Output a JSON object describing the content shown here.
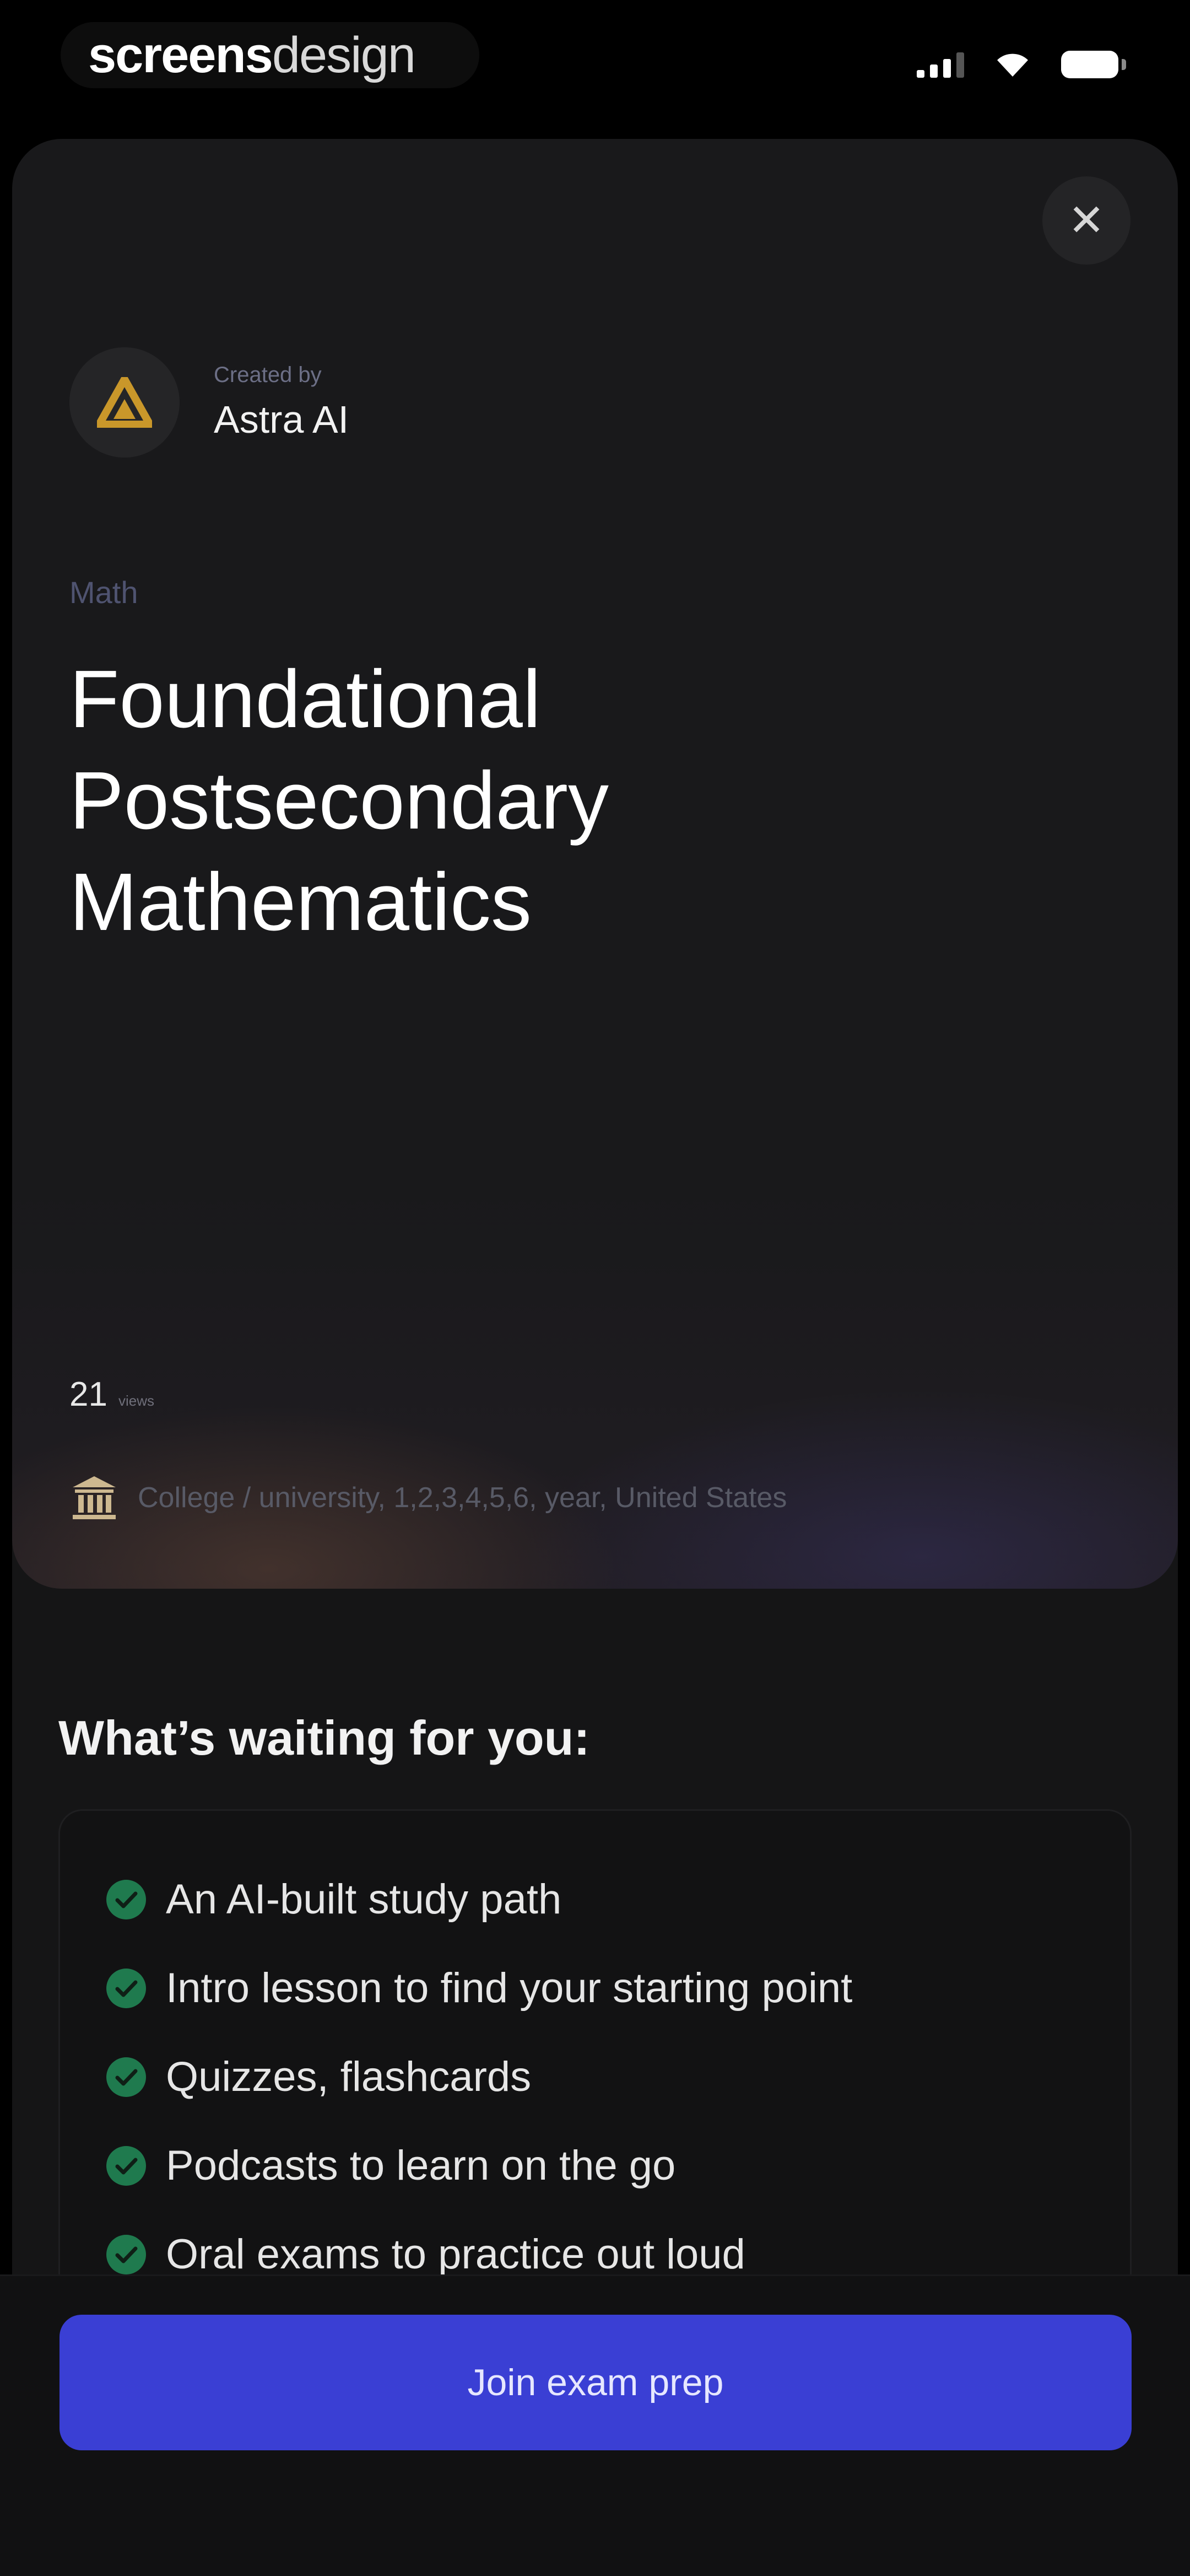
{
  "status_bar": {
    "logo_bold": "screens",
    "logo_light": "design",
    "icons": [
      "signal-icon",
      "wifi-icon",
      "battery-icon"
    ]
  },
  "sheet": {
    "close_icon": "close-icon",
    "creator": {
      "created_by_label": "Created by",
      "name": "Astra AI",
      "avatar_icon": "astra-logo-icon"
    },
    "subject": "Math",
    "title": "Foundational Postsecondary Mathematics",
    "count": {
      "value": "21",
      "label": "views"
    },
    "meta": {
      "icon": "institution-icon",
      "text": "College / university, 1,2,3,4,5,6, year, United States"
    }
  },
  "features": {
    "heading": "What’s waiting for you:",
    "items": [
      "An AI-built study path",
      "Intro lesson to find your starting point",
      "Quizzes, flashcards",
      "Podcasts to learn on the go",
      "Oral exams to practice out loud"
    ]
  },
  "cta": {
    "label": "Join exam prep"
  },
  "colors": {
    "background": "#000000",
    "sheet": "#151516",
    "accent_button": "#3a3fd4",
    "check_green": "#1f7a4e",
    "avatar_gold": "#c9972a"
  }
}
